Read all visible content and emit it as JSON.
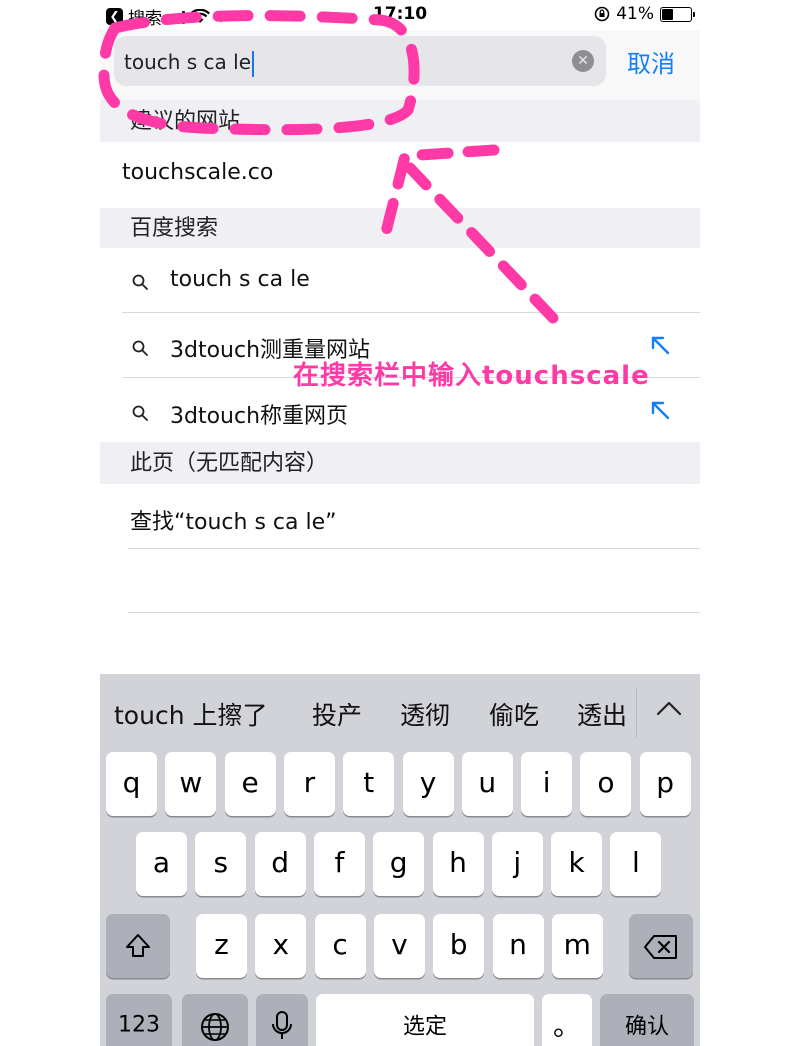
{
  "status_bar": {
    "back_label": "搜索",
    "time": "17:10",
    "battery": "41%",
    "battery_level": 0.41
  },
  "search": {
    "query": "touch s ca le",
    "cancel_label": "取消"
  },
  "sections": {
    "suggested": {
      "header": "建议的网站",
      "items": [
        "touchscale.co"
      ]
    },
    "baidu": {
      "header": "百度搜索",
      "items": [
        "touch s ca le",
        "3dtouch测重量网站",
        "3dtouch称重网页"
      ]
    },
    "this_page": {
      "header": "此页（无匹配内容）",
      "find_label": "查找“touch s ca le”"
    }
  },
  "annotation": {
    "text": "在搜索栏中输入touchscale",
    "color": "#ff3aa6"
  },
  "keyboard": {
    "candidates": [
      "touch 上擦了",
      "投产",
      "透彻",
      "偷吃",
      "透出"
    ],
    "row1": [
      "q",
      "w",
      "e",
      "r",
      "t",
      "y",
      "u",
      "i",
      "o",
      "p"
    ],
    "row2": [
      "a",
      "s",
      "d",
      "f",
      "g",
      "h",
      "j",
      "k",
      "l"
    ],
    "row3": [
      "z",
      "x",
      "c",
      "v",
      "b",
      "n",
      "m"
    ],
    "numbers_label": "123",
    "space_label": "选定",
    "period_label": "。",
    "return_label": "确认"
  },
  "colors": {
    "accent": "#147efb",
    "annotation": "#ff3aa6",
    "keyboard_bg": "#d1d3d9"
  }
}
